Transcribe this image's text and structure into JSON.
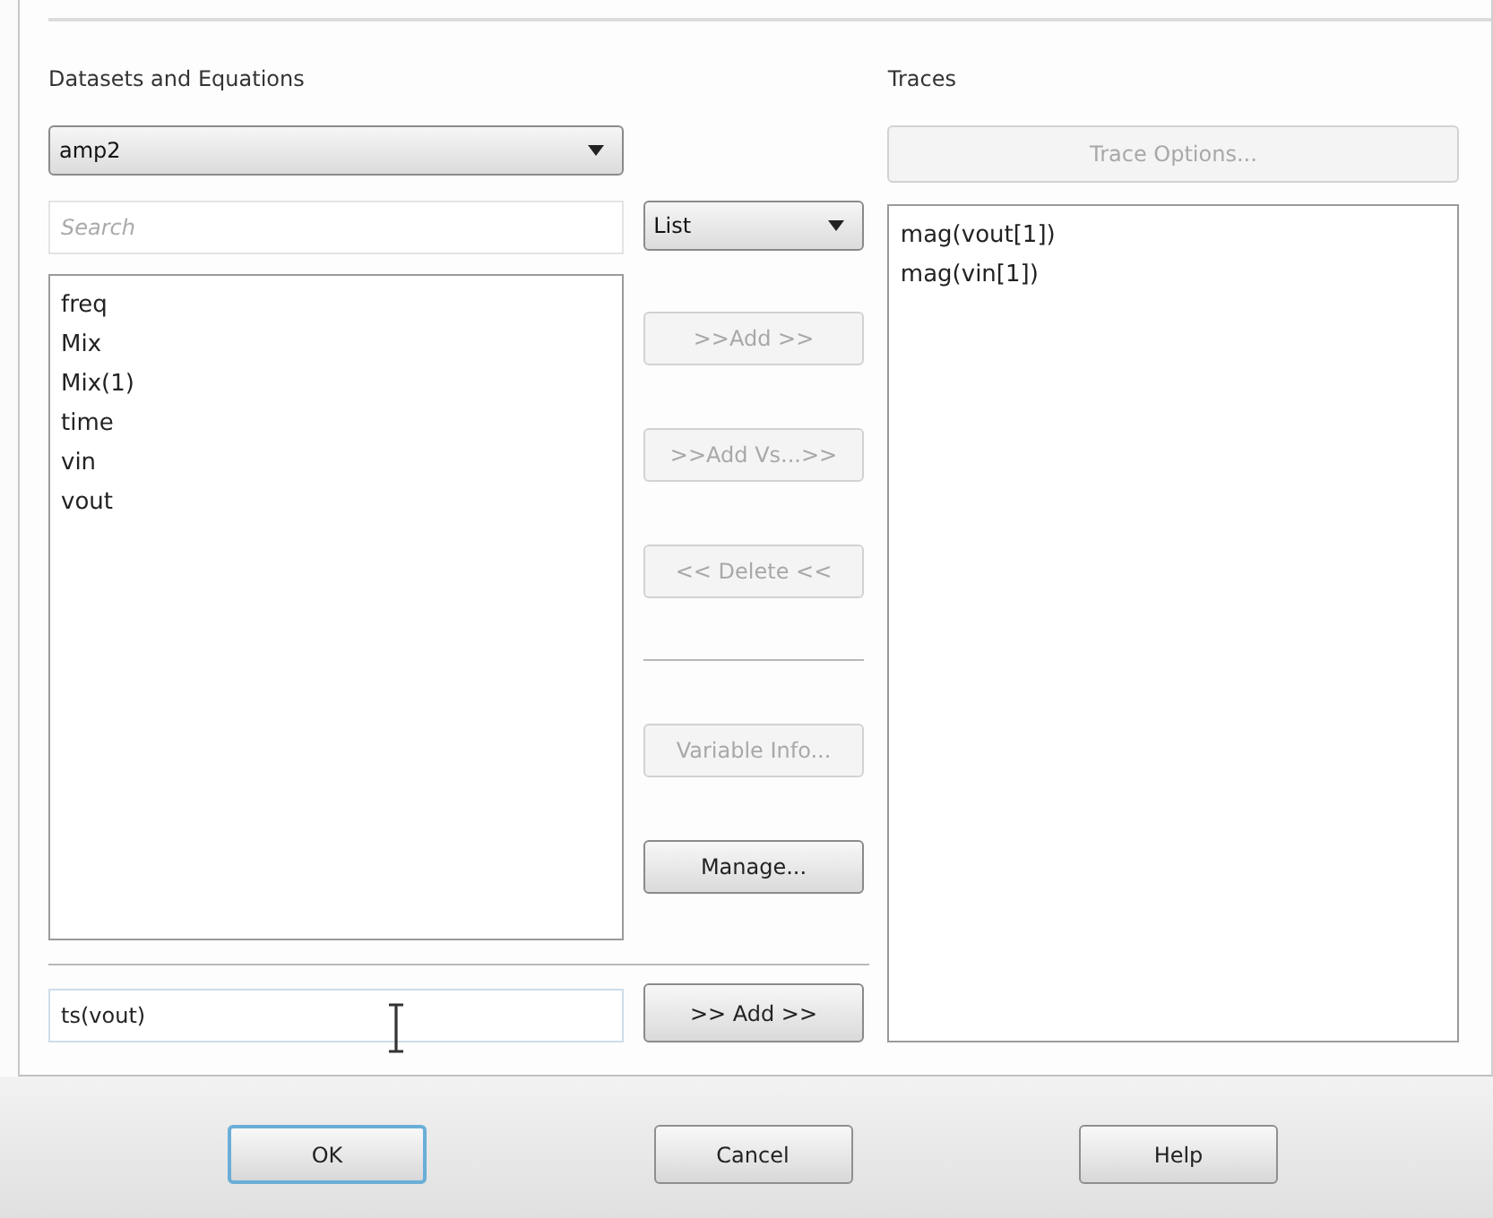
{
  "datasets": {
    "label": "Datasets and Equations",
    "dataset_select": {
      "value": "amp2"
    },
    "search": {
      "placeholder": "Search"
    },
    "variables": [
      {
        "label": "freq"
      },
      {
        "label": "Mix"
      },
      {
        "label": "Mix(1)"
      },
      {
        "label": "time"
      },
      {
        "label": "vin"
      },
      {
        "label": "vout"
      }
    ],
    "expression": {
      "value": "ts(vout)"
    }
  },
  "middle": {
    "view_select": {
      "value": "List"
    },
    "buttons": [
      {
        "label": ">>Add >>",
        "disabled": true
      },
      {
        "label": ">>Add Vs...>>",
        "disabled": true
      },
      {
        "label": "<< Delete <<",
        "disabled": true
      }
    ],
    "lower_buttons": [
      {
        "label": "Variable Info...",
        "disabled": true
      },
      {
        "label": "Manage...",
        "disabled": false
      }
    ],
    "expression_add": {
      "label": ">> Add >>",
      "disabled": false
    }
  },
  "traces": {
    "label": "Traces",
    "options_button": {
      "label": "Trace Options...",
      "disabled": true
    },
    "items": [
      {
        "label": "mag(vout[1])"
      },
      {
        "label": "mag(vin[1])"
      }
    ]
  },
  "footer": {
    "buttons": [
      {
        "label": "OK",
        "focused": true
      },
      {
        "label": "Cancel",
        "focused": false
      },
      {
        "label": "Help",
        "focused": false
      }
    ]
  }
}
